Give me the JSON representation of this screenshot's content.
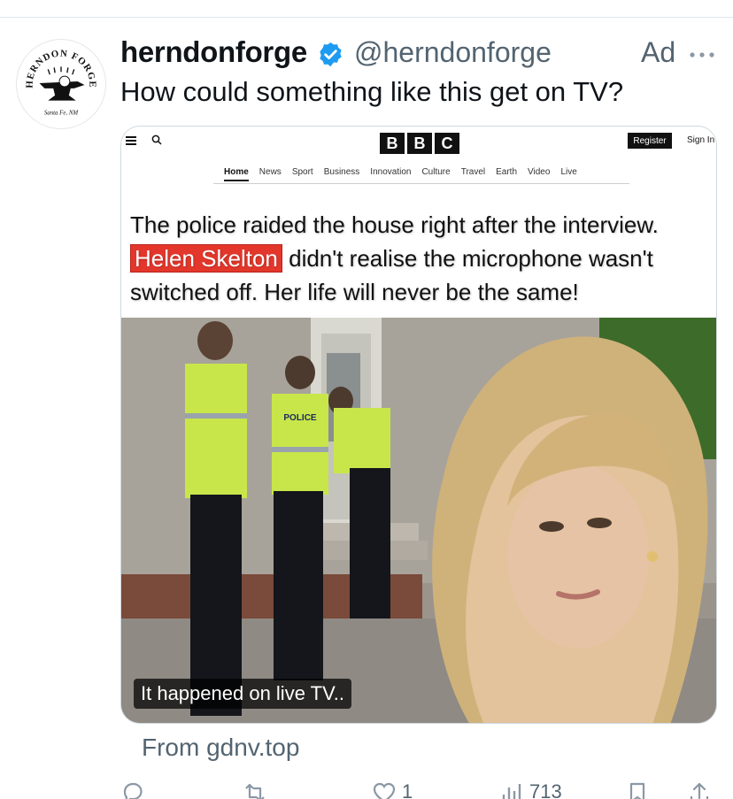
{
  "tweet": {
    "display_name": "herndonforge",
    "handle": "@herndonforge",
    "ad_label": "Ad",
    "text": "How could something like this get on TV?",
    "avatar": {
      "top_text": "HERNDON FORGE",
      "bottom_text": "Santa Fe, NM"
    },
    "from_link": "From gdnv.top"
  },
  "card": {
    "site_header": {
      "logo_letters": [
        "B",
        "B",
        "C"
      ],
      "register_label": "Register",
      "signin_label": "Sign In"
    },
    "nav": [
      "Home",
      "News",
      "Sport",
      "Business",
      "Innovation",
      "Culture",
      "Travel",
      "Earth",
      "Video",
      "Live"
    ],
    "headline": {
      "line1": "The police raided the house right after the interview.",
      "name": "Helen Skelton",
      "line2_rest": " didn't realise the microphone wasn't",
      "line3": "switched off. Her life will never be the same!"
    },
    "photo": {
      "police_label": "POLICE"
    },
    "caption": "It happened on live TV.."
  },
  "actions": {
    "replies": "",
    "retweets": "",
    "likes": "1",
    "views": "713"
  },
  "colors": {
    "text": "#0f1419",
    "muted": "#536471",
    "verified": "#1d9bf0",
    "highlight": "#e3372c"
  }
}
